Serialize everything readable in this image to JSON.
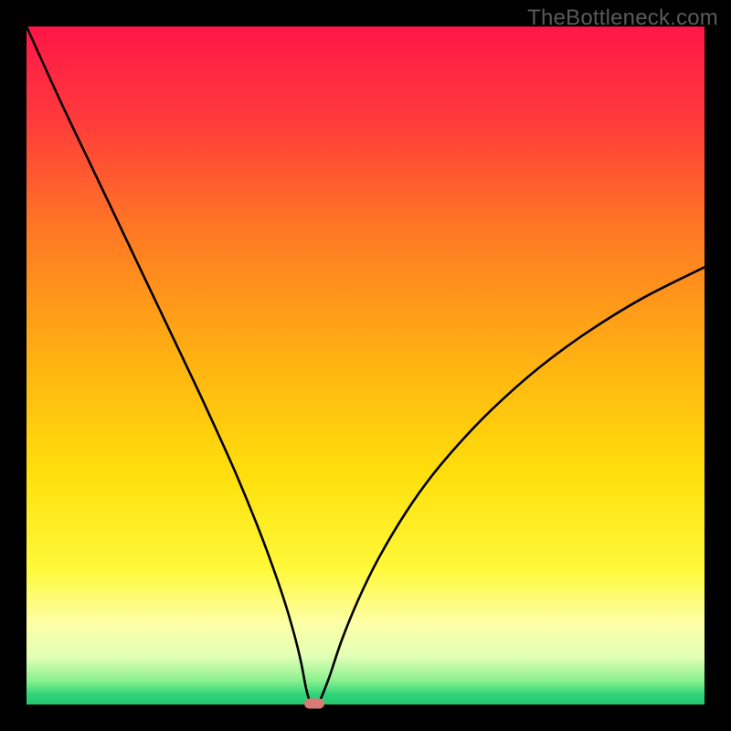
{
  "watermark": "TheBottleneck.com",
  "chart_data": {
    "type": "line",
    "title": "",
    "xlabel": "",
    "ylabel": "",
    "xlim": [
      0,
      100
    ],
    "ylim": [
      0,
      100
    ],
    "grid": false,
    "legend": false,
    "gradient_stops": [
      {
        "offset": 0.0,
        "color": "#ff1648"
      },
      {
        "offset": 0.14,
        "color": "#ff3b3b"
      },
      {
        "offset": 0.3,
        "color": "#ff7824"
      },
      {
        "offset": 0.5,
        "color": "#ffb411"
      },
      {
        "offset": 0.66,
        "color": "#ffdf0c"
      },
      {
        "offset": 0.8,
        "color": "#fff93a"
      },
      {
        "offset": 0.88,
        "color": "#fdffa7"
      },
      {
        "offset": 0.93,
        "color": "#e1ffb5"
      },
      {
        "offset": 0.965,
        "color": "#8af08e"
      },
      {
        "offset": 0.985,
        "color": "#32d47a"
      },
      {
        "offset": 1.0,
        "color": "#22c76e"
      }
    ],
    "series": [
      {
        "name": "bottleneck-curve",
        "x": [
          0,
          5,
          10,
          15,
          20,
          25,
          28,
          31,
          34,
          36,
          38,
          39.5,
          40.5,
          41.3,
          42,
          43,
          44.5,
          46.5,
          49,
          52,
          56,
          60,
          65,
          70,
          76,
          83,
          91,
          100
        ],
        "y": [
          100,
          89,
          78.5,
          68,
          57.5,
          47,
          40.5,
          33.8,
          26.5,
          21.2,
          15.4,
          10.3,
          6.2,
          2.1,
          0.1,
          0.1,
          3.6,
          9.5,
          15.6,
          21.7,
          28.4,
          34.0,
          39.8,
          44.8,
          50.0,
          55.1,
          60.0,
          64.5
        ]
      }
    ],
    "marker": {
      "x": 42.4,
      "y": 0.1
    }
  }
}
